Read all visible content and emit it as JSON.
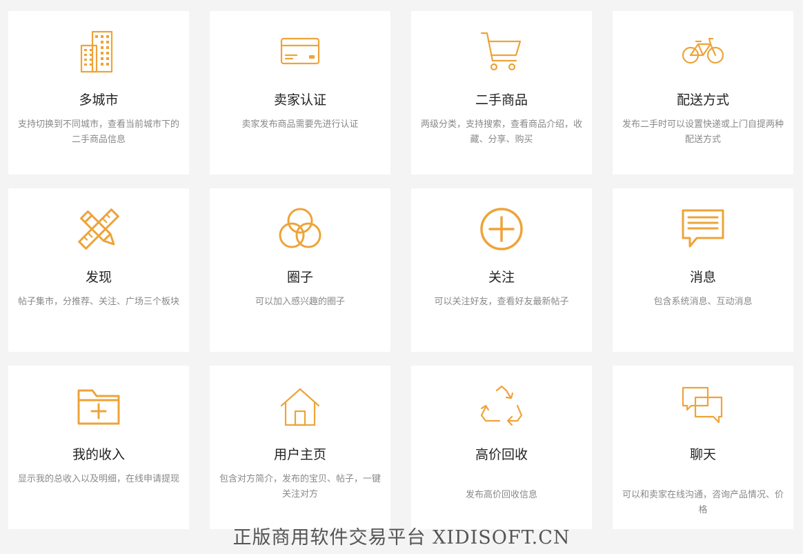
{
  "features": [
    {
      "icon": "city-buildings-icon",
      "title": "多城市",
      "desc": "支持切换到不同城市，查看当前城市下的二手商品信息"
    },
    {
      "icon": "credit-card-icon",
      "title": "卖家认证",
      "desc": "卖家发布商品需要先进行认证"
    },
    {
      "icon": "shopping-cart-icon",
      "title": "二手商品",
      "desc": "两级分类，支持搜索，查看商品介绍，收藏、分享、购买"
    },
    {
      "icon": "bicycle-icon",
      "title": "配送方式",
      "desc": "发布二手时可以设置快递或上门自提两种配送方式"
    },
    {
      "icon": "pencil-ruler-icon",
      "title": "发现",
      "desc": "帖子集市，分推荐、关注、广场三个板块"
    },
    {
      "icon": "overlapping-circles-icon",
      "title": "圈子",
      "desc": "可以加入感兴趣的圈子"
    },
    {
      "icon": "plus-circle-icon",
      "title": "关注",
      "desc": "可以关注好友，查看好友最新帖子"
    },
    {
      "icon": "message-icon",
      "title": "消息",
      "desc": "包含系统消息、互动消息"
    },
    {
      "icon": "folder-plus-icon",
      "title": "我的收入",
      "desc": "显示我的总收入以及明细，在线申请提现"
    },
    {
      "icon": "home-icon",
      "title": "用户主页",
      "desc": "包含对方简介，发布的宝贝、帖子，一键关注对方"
    },
    {
      "icon": "recycle-icon",
      "title": "高价回收",
      "desc": "发布高价回收信息"
    },
    {
      "icon": "chat-bubbles-icon",
      "title": "聊天",
      "desc": "可以和卖家在线沟通，咨询产品情况、价格"
    }
  ],
  "watermark": "正版商用软件交易平台 XIDISOFT.CN",
  "colors": {
    "accent": "#eea338",
    "background": "#f4f4f4",
    "card": "#ffffff",
    "title": "#222222",
    "desc": "#888888"
  }
}
